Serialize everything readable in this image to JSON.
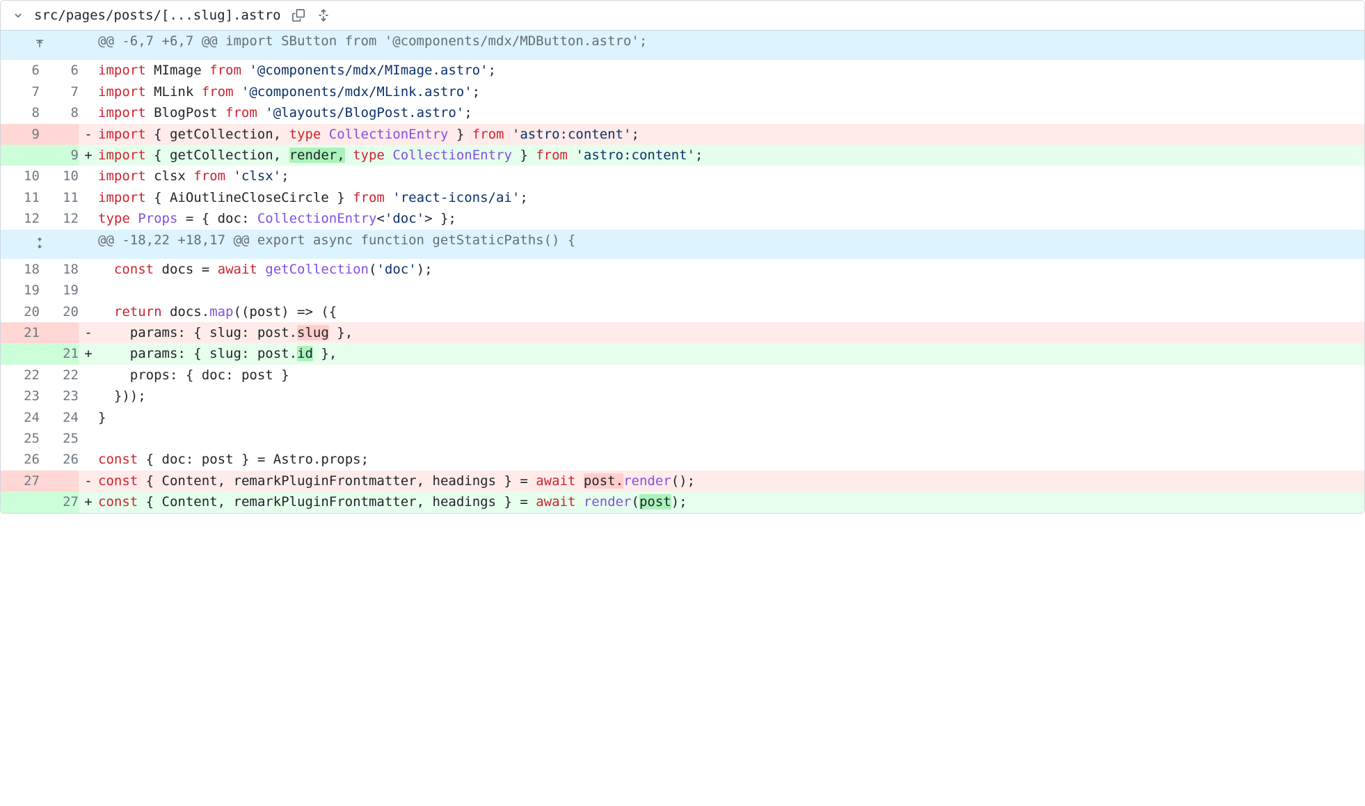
{
  "file": {
    "path": "src/pages/posts/[...slug].astro"
  },
  "hunks": [
    {
      "header": "@@ -6,7 +6,7 @@ import SButton from '@components/mdx/MDButton.astro';",
      "expand": "up",
      "lines": [
        {
          "type": "ctx",
          "old": "6",
          "new": "6",
          "tokens": [
            {
              "t": "import ",
              "c": "tok-kw"
            },
            {
              "t": "MImage",
              "c": "tok-var"
            },
            {
              "t": " from ",
              "c": "tok-kw"
            },
            {
              "t": "'@components/mdx/MImage.astro'",
              "c": "tok-str"
            },
            {
              "t": ";",
              "c": ""
            }
          ]
        },
        {
          "type": "ctx",
          "old": "7",
          "new": "7",
          "tokens": [
            {
              "t": "import ",
              "c": "tok-kw"
            },
            {
              "t": "MLink",
              "c": "tok-var"
            },
            {
              "t": " from ",
              "c": "tok-kw"
            },
            {
              "t": "'@components/mdx/MLink.astro'",
              "c": "tok-str"
            },
            {
              "t": ";",
              "c": ""
            }
          ]
        },
        {
          "type": "ctx",
          "old": "8",
          "new": "8",
          "tokens": [
            {
              "t": "import ",
              "c": "tok-kw"
            },
            {
              "t": "BlogPost",
              "c": "tok-var"
            },
            {
              "t": " from ",
              "c": "tok-kw"
            },
            {
              "t": "'@layouts/BlogPost.astro'",
              "c": "tok-str"
            },
            {
              "t": ";",
              "c": ""
            }
          ]
        },
        {
          "type": "del",
          "old": "9",
          "new": "",
          "tokens": [
            {
              "t": "import ",
              "c": "tok-kw"
            },
            {
              "t": "{ ",
              "c": ""
            },
            {
              "t": "getCollection",
              "c": "tok-var"
            },
            {
              "t": ", ",
              "c": ""
            },
            {
              "t": "type ",
              "c": "tok-kw"
            },
            {
              "t": "CollectionEntry",
              "c": "tok-type"
            },
            {
              "t": " } ",
              "c": ""
            },
            {
              "t": "from ",
              "c": "tok-kw"
            },
            {
              "t": "'astro:content'",
              "c": "tok-str"
            },
            {
              "t": ";",
              "c": ""
            }
          ]
        },
        {
          "type": "add",
          "old": "",
          "new": "9",
          "tokens": [
            {
              "t": "import ",
              "c": "tok-kw"
            },
            {
              "t": "{ ",
              "c": ""
            },
            {
              "t": "getCollection",
              "c": "tok-var"
            },
            {
              "t": ", ",
              "c": ""
            },
            {
              "t": "render,",
              "c": "tok-var",
              "hl": "add"
            },
            {
              "t": " ",
              "c": ""
            },
            {
              "t": "type ",
              "c": "tok-kw"
            },
            {
              "t": "CollectionEntry",
              "c": "tok-type"
            },
            {
              "t": " } ",
              "c": ""
            },
            {
              "t": "from ",
              "c": "tok-kw"
            },
            {
              "t": "'astro:content'",
              "c": "tok-str"
            },
            {
              "t": ";",
              "c": ""
            }
          ]
        },
        {
          "type": "ctx",
          "old": "10",
          "new": "10",
          "tokens": [
            {
              "t": "import ",
              "c": "tok-kw"
            },
            {
              "t": "clsx",
              "c": "tok-var"
            },
            {
              "t": " from ",
              "c": "tok-kw"
            },
            {
              "t": "'clsx'",
              "c": "tok-str"
            },
            {
              "t": ";",
              "c": ""
            }
          ]
        },
        {
          "type": "ctx",
          "old": "11",
          "new": "11",
          "tokens": [
            {
              "t": "import ",
              "c": "tok-kw"
            },
            {
              "t": "{ ",
              "c": ""
            },
            {
              "t": "AiOutlineCloseCircle",
              "c": "tok-var"
            },
            {
              "t": " } ",
              "c": ""
            },
            {
              "t": "from ",
              "c": "tok-kw"
            },
            {
              "t": "'react-icons/ai'",
              "c": "tok-str"
            },
            {
              "t": ";",
              "c": ""
            }
          ]
        },
        {
          "type": "ctx",
          "old": "12",
          "new": "12",
          "tokens": [
            {
              "t": "type ",
              "c": "tok-kw"
            },
            {
              "t": "Props",
              "c": "tok-type"
            },
            {
              "t": " = { ",
              "c": ""
            },
            {
              "t": "doc",
              "c": "tok-prop"
            },
            {
              "t": ": ",
              "c": ""
            },
            {
              "t": "CollectionEntry",
              "c": "tok-type"
            },
            {
              "t": "<",
              "c": ""
            },
            {
              "t": "'doc'",
              "c": "tok-str"
            },
            {
              "t": "> };",
              "c": ""
            }
          ]
        }
      ]
    },
    {
      "header": "@@ -18,22 +18,17 @@ export async function getStaticPaths() {",
      "expand": "both",
      "lines": [
        {
          "type": "ctx",
          "old": "18",
          "new": "18",
          "indent": "  ",
          "tokens": [
            {
              "t": "const ",
              "c": "tok-kw"
            },
            {
              "t": "docs",
              "c": "tok-var"
            },
            {
              "t": " = ",
              "c": ""
            },
            {
              "t": "await ",
              "c": "tok-kw"
            },
            {
              "t": "getCollection",
              "c": "tok-fn"
            },
            {
              "t": "(",
              "c": ""
            },
            {
              "t": "'doc'",
              "c": "tok-str"
            },
            {
              "t": ");",
              "c": ""
            }
          ]
        },
        {
          "type": "ctx",
          "old": "19",
          "new": "19",
          "tokens": []
        },
        {
          "type": "ctx",
          "old": "20",
          "new": "20",
          "indent": "  ",
          "tokens": [
            {
              "t": "return ",
              "c": "tok-kw"
            },
            {
              "t": "docs.",
              "c": "tok-var"
            },
            {
              "t": "map",
              "c": "tok-fn"
            },
            {
              "t": "((",
              "c": ""
            },
            {
              "t": "post",
              "c": "tok-var"
            },
            {
              "t": ") => ({",
              "c": ""
            }
          ]
        },
        {
          "type": "del",
          "old": "21",
          "new": "",
          "indent": "    ",
          "tokens": [
            {
              "t": "params",
              "c": "tok-prop"
            },
            {
              "t": ": { ",
              "c": ""
            },
            {
              "t": "slug",
              "c": "tok-prop"
            },
            {
              "t": ": ",
              "c": ""
            },
            {
              "t": "post",
              "c": "tok-var"
            },
            {
              "t": ".",
              "c": ""
            },
            {
              "t": "slug",
              "c": "tok-var",
              "hl": "del"
            },
            {
              "t": " },",
              "c": ""
            }
          ]
        },
        {
          "type": "add",
          "old": "",
          "new": "21",
          "indent": "    ",
          "tokens": [
            {
              "t": "params",
              "c": "tok-prop"
            },
            {
              "t": ": { ",
              "c": ""
            },
            {
              "t": "slug",
              "c": "tok-prop"
            },
            {
              "t": ": ",
              "c": ""
            },
            {
              "t": "post",
              "c": "tok-var"
            },
            {
              "t": ".",
              "c": ""
            },
            {
              "t": "id",
              "c": "tok-var",
              "hl": "add"
            },
            {
              "t": " },",
              "c": ""
            }
          ]
        },
        {
          "type": "ctx",
          "old": "22",
          "new": "22",
          "indent": "    ",
          "tokens": [
            {
              "t": "props",
              "c": "tok-prop"
            },
            {
              "t": ": { ",
              "c": ""
            },
            {
              "t": "doc",
              "c": "tok-prop"
            },
            {
              "t": ": ",
              "c": ""
            },
            {
              "t": "post",
              "c": "tok-var"
            },
            {
              "t": " }",
              "c": ""
            }
          ]
        },
        {
          "type": "ctx",
          "old": "23",
          "new": "23",
          "indent": "  ",
          "tokens": [
            {
              "t": "}));",
              "c": ""
            }
          ]
        },
        {
          "type": "ctx",
          "old": "24",
          "new": "24",
          "tokens": [
            {
              "t": "}",
              "c": ""
            }
          ]
        },
        {
          "type": "ctx",
          "old": "25",
          "new": "25",
          "tokens": []
        },
        {
          "type": "ctx",
          "old": "26",
          "new": "26",
          "tokens": [
            {
              "t": "const ",
              "c": "tok-kw"
            },
            {
              "t": "{ ",
              "c": ""
            },
            {
              "t": "doc",
              "c": "tok-prop"
            },
            {
              "t": ": ",
              "c": ""
            },
            {
              "t": "post",
              "c": "tok-var"
            },
            {
              "t": " } = ",
              "c": ""
            },
            {
              "t": "Astro",
              "c": "tok-var"
            },
            {
              "t": ".",
              "c": ""
            },
            {
              "t": "props",
              "c": "tok-var"
            },
            {
              "t": ";",
              "c": ""
            }
          ]
        },
        {
          "type": "del",
          "old": "27",
          "new": "",
          "tokens": [
            {
              "t": "const ",
              "c": "tok-kw"
            },
            {
              "t": "{ ",
              "c": ""
            },
            {
              "t": "Content",
              "c": "tok-var"
            },
            {
              "t": ", ",
              "c": ""
            },
            {
              "t": "remarkPluginFrontmatter",
              "c": "tok-var"
            },
            {
              "t": ", ",
              "c": ""
            },
            {
              "t": "headings",
              "c": "tok-var"
            },
            {
              "t": " } = ",
              "c": ""
            },
            {
              "t": "await ",
              "c": "tok-kw"
            },
            {
              "t": "post.",
              "c": "tok-var",
              "hl": "del"
            },
            {
              "t": "render",
              "c": "tok-fn"
            },
            {
              "t": "(",
              "c": ""
            },
            {
              "t": ");",
              "c": ""
            }
          ]
        },
        {
          "type": "add",
          "old": "",
          "new": "27",
          "tokens": [
            {
              "t": "const ",
              "c": "tok-kw"
            },
            {
              "t": "{ ",
              "c": ""
            },
            {
              "t": "Content",
              "c": "tok-var"
            },
            {
              "t": ", ",
              "c": ""
            },
            {
              "t": "remarkPluginFrontmatter",
              "c": "tok-var"
            },
            {
              "t": ", ",
              "c": ""
            },
            {
              "t": "headings",
              "c": "tok-var"
            },
            {
              "t": " } = ",
              "c": ""
            },
            {
              "t": "await ",
              "c": "tok-kw"
            },
            {
              "t": "render",
              "c": "tok-fn"
            },
            {
              "t": "(",
              "c": ""
            },
            {
              "t": "post",
              "c": "tok-var",
              "hl": "add"
            },
            {
              "t": ");",
              "c": ""
            }
          ]
        }
      ]
    }
  ]
}
